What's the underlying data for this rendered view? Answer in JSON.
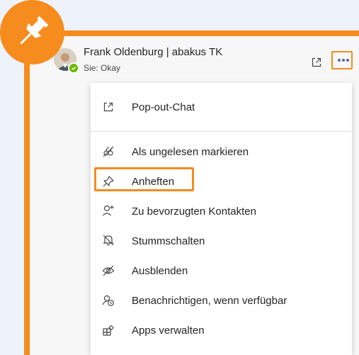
{
  "colors": {
    "accent_orange": "#f68c1e",
    "background": "#eef3fb",
    "teams_purple": "#6264a7",
    "presence_available": "#6bb700"
  },
  "header": {
    "contact_name": "Frank Oldenburg | abakus TK",
    "last_message": "Sie: Okay",
    "popout_icon": "popout-icon",
    "more_icon": "more-options-icon"
  },
  "badge": {
    "icon": "pin-icon"
  },
  "menu": {
    "items": [
      {
        "label": "Pop-out-Chat",
        "icon": "popout-icon"
      },
      {
        "label": "Als ungelesen markieren",
        "icon": "mark-unread-icon"
      },
      {
        "label": "Anheften",
        "icon": "pin-icon",
        "highlighted": true
      },
      {
        "label": "Zu bevorzugten Kontakten",
        "icon": "add-contact-icon"
      },
      {
        "label": "Stummschalten",
        "icon": "mute-bell-icon"
      },
      {
        "label": "Ausblenden",
        "icon": "hide-eye-icon"
      },
      {
        "label": "Benachrichtigen, wenn verfügbar",
        "icon": "notify-available-icon"
      },
      {
        "label": "Apps verwalten",
        "icon": "apps-icon"
      }
    ]
  }
}
